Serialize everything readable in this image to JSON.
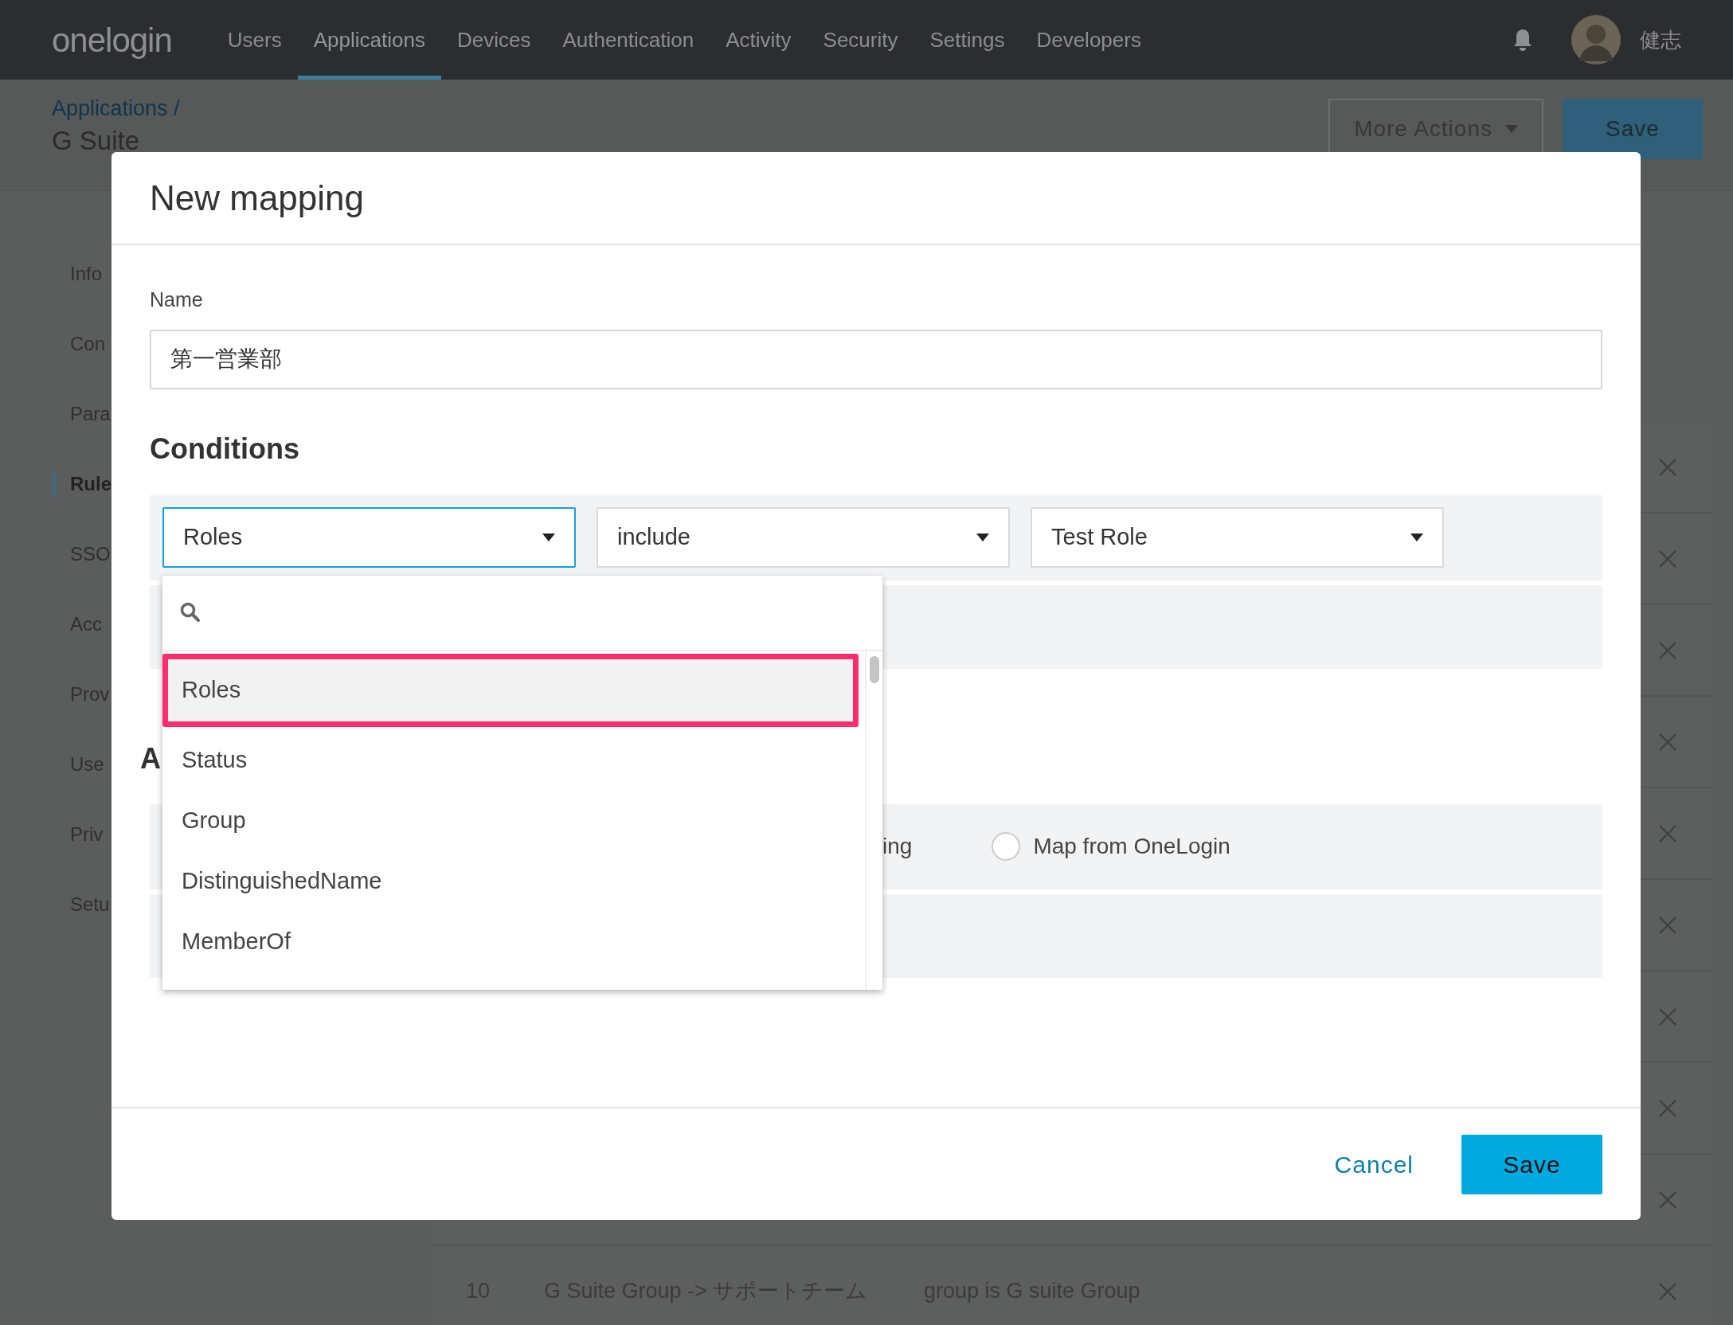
{
  "navbar": {
    "logo": "onelogin",
    "items": [
      {
        "label": "Users",
        "selected": false
      },
      {
        "label": "Applications",
        "selected": true
      },
      {
        "label": "Devices",
        "selected": false
      },
      {
        "label": "Authentication",
        "selected": false
      },
      {
        "label": "Activity",
        "selected": false
      },
      {
        "label": "Security",
        "selected": false
      },
      {
        "label": "Settings",
        "selected": false
      },
      {
        "label": "Developers",
        "selected": false
      }
    ],
    "user": {
      "name": "健志"
    }
  },
  "page": {
    "breadcrumb": "Applications /",
    "title": "G Suite",
    "buttons": [
      {
        "label": "More Actions",
        "kind": "dropdown"
      },
      {
        "label": "Save",
        "kind": "primary"
      }
    ],
    "sidebar": {
      "items": [
        {
          "label": "Info",
          "selected": false
        },
        {
          "label": "Con",
          "selected": false
        },
        {
          "label": "Para",
          "selected": false
        },
        {
          "label": "Rule",
          "selected": true
        },
        {
          "label": "SSO",
          "selected": false
        },
        {
          "label": "Acc",
          "selected": false
        },
        {
          "label": "Prov",
          "selected": false
        },
        {
          "label": "Use",
          "selected": false
        },
        {
          "label": "Priv",
          "selected": false
        },
        {
          "label": "Setu",
          "selected": false
        }
      ]
    },
    "rules_table": {
      "rows": [
        {
          "number": "10",
          "name": "G Suite Group -> サポートチーム",
          "condition": "group is G suite Group"
        }
      ]
    }
  },
  "modal": {
    "title": "New mapping",
    "name_field": {
      "label": "Name",
      "value": "第一営業部"
    },
    "conditions": {
      "heading": "Conditions",
      "selects": [
        {
          "value": "Roles",
          "focused": true
        },
        {
          "value": "include",
          "focused": false
        },
        {
          "value": "Test Role",
          "focused": false
        }
      ],
      "dropdown": {
        "items": [
          {
            "label": "Roles",
            "selected": true
          },
          {
            "label": "Status",
            "selected": false
          },
          {
            "label": "Group",
            "selected": false
          },
          {
            "label": "DistinguishedName",
            "selected": false
          },
          {
            "label": "MemberOf",
            "selected": false
          }
        ]
      }
    },
    "actions": {
      "heading": "A",
      "options": [
        {
          "kind": "text",
          "label": "ing"
        },
        {
          "kind": "radio",
          "label": "Map from OneLogin",
          "checked": false
        }
      ]
    },
    "footer": {
      "cancel": "Cancel",
      "save": "Save"
    }
  }
}
